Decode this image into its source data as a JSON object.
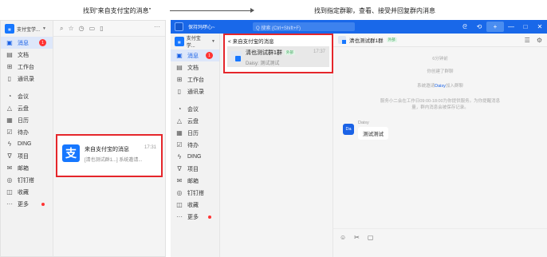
{
  "annotations": {
    "step1": "找到“来自支付宝的消息”",
    "step2": "找到指定群聊，查看、接受并回复群内消息"
  },
  "colors": {
    "accent": "#1968e9",
    "highlight": "#e5262b",
    "badge": "#ff3333"
  },
  "panel1": {
    "account_name": "支付宝学...",
    "toolbar_more": "···",
    "nav": [
      {
        "label": "消息",
        "icon": "message-icon",
        "glyph": "▣",
        "badge": "1",
        "active": true
      },
      {
        "label": "文档",
        "icon": "document-icon",
        "glyph": "▤"
      },
      {
        "label": "工作台",
        "icon": "workbench-icon",
        "glyph": "⊞"
      },
      {
        "label": "通讯录",
        "icon": "contacts-icon",
        "glyph": "▯"
      },
      {
        "label": "会议",
        "icon": "meeting-icon",
        "glyph": "◔",
        "gap": true
      },
      {
        "label": "云盘",
        "icon": "cloud-drive-icon",
        "glyph": "△"
      },
      {
        "label": "日历",
        "icon": "calendar-icon",
        "glyph": "▦"
      },
      {
        "label": "待办",
        "icon": "todo-icon",
        "glyph": "☑"
      },
      {
        "label": "DING",
        "icon": "ding-icon",
        "glyph": "ϟ"
      },
      {
        "label": "项目",
        "icon": "project-icon",
        "glyph": "∇"
      },
      {
        "label": "邮箱",
        "icon": "mail-icon",
        "glyph": "✉"
      },
      {
        "label": "钉钉搭",
        "icon": "dingda-icon",
        "glyph": "◎"
      },
      {
        "label": "收藏",
        "icon": "favorites-icon",
        "glyph": "◫"
      },
      {
        "label": "更多",
        "icon": "more-icon",
        "glyph": "···",
        "dot": true
      }
    ],
    "message": {
      "title": "来自支付宝的消息",
      "time": "17:31",
      "preview": "[清也测试群1...] 系统邀请...",
      "icon_glyph": "支"
    }
  },
  "panel2": {
    "status": "保持玛啰心~",
    "search_placeholder": "Q 搜索 (Ctrl+Shift+F)",
    "window_controls": [
      "ᘓ",
      "⟲",
      "+",
      "—",
      "□",
      "✕"
    ],
    "account_name": "支付宝学...",
    "nav": [
      {
        "label": "消息",
        "icon": "message-icon",
        "glyph": "▣",
        "badge": "1",
        "active": true
      },
      {
        "label": "文档",
        "icon": "document-icon",
        "glyph": "▤"
      },
      {
        "label": "工作台",
        "icon": "workbench-icon",
        "glyph": "⊞"
      },
      {
        "label": "通讯录",
        "icon": "contacts-icon",
        "glyph": "▯"
      },
      {
        "label": "会议",
        "icon": "meeting-icon",
        "glyph": "◔",
        "gap": true
      },
      {
        "label": "云盘",
        "icon": "cloud-drive-icon",
        "glyph": "△"
      },
      {
        "label": "日历",
        "icon": "calendar-icon",
        "glyph": "▦"
      },
      {
        "label": "待办",
        "icon": "todo-icon",
        "glyph": "☑"
      },
      {
        "label": "DING",
        "icon": "ding-icon",
        "glyph": "ϟ"
      },
      {
        "label": "项目",
        "icon": "project-icon",
        "glyph": "∇"
      },
      {
        "label": "邮箱",
        "icon": "mail-icon",
        "glyph": "✉"
      },
      {
        "label": "钉钉搭",
        "icon": "dingda-icon",
        "glyph": "◎"
      },
      {
        "label": "收藏",
        "icon": "favorites-icon",
        "glyph": "◫"
      },
      {
        "label": "更多",
        "icon": "more-icon",
        "glyph": "···",
        "dot": true
      }
    ],
    "back_label": "< 来自支付宝的消息",
    "group": {
      "name": "清也测试群1群",
      "tag": "外部",
      "preview": "Daisy: 测试测试",
      "time": "17:37"
    },
    "chat": {
      "title": "清也测试群1群",
      "tag": "外部",
      "sys1": "6分钟前",
      "sys2": "你创建了群聊",
      "sys3_pre": "系统邀请",
      "sys3_name": "Daisy",
      "sys3_post": "加入群聊",
      "sys4": "服务小二会在工作日09:00-18:00为你提供服务。为你提醒消息量，群内消息会被保存记录。",
      "sender": "Daisy",
      "avatar_text": "Da",
      "bubble": "测试测试",
      "tools": [
        "☺",
        "✂",
        "▢"
      ],
      "head_tools": [
        "☰",
        "⚙"
      ]
    }
  }
}
